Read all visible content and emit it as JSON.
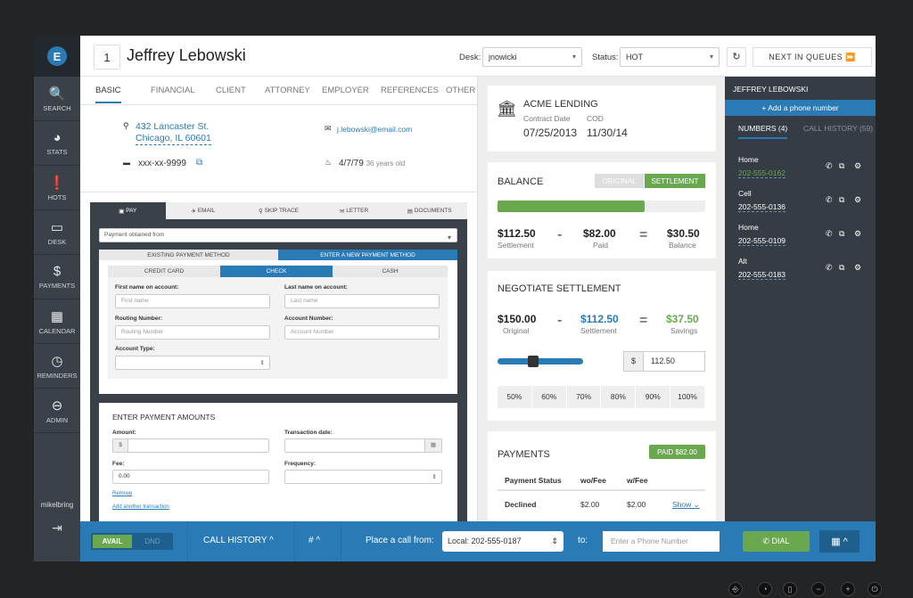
{
  "sidebar": {
    "logo": "E",
    "items": [
      {
        "label": "SEARCH",
        "icon": "🔍"
      },
      {
        "label": "STATS",
        "icon": "◕"
      },
      {
        "label": "HOTS",
        "icon": "❗"
      },
      {
        "label": "DESK",
        "icon": "▭"
      },
      {
        "label": "PAYMENTS",
        "icon": "$"
      },
      {
        "label": "CALENDAR",
        "icon": "▦"
      },
      {
        "label": "REMINDERS",
        "icon": "◷"
      },
      {
        "label": "ADMIN",
        "icon": "⊖"
      }
    ],
    "user": "mikelbring",
    "logout_icon": "⇥"
  },
  "header": {
    "queue_number": "1",
    "name": "Jeffrey Lebowski",
    "desk_label": "Desk:",
    "desk_value": "jnowicki",
    "status_label": "Status:",
    "status_value": "HOT",
    "refresh_icon": "↻",
    "next_label": "NEXT IN QUEUES ⏩"
  },
  "tabs": [
    "BASIC",
    "FINANCIAL",
    "CLIENT",
    "ATTORNEY",
    "EMPLOYER",
    "REFERENCES",
    "OTHER"
  ],
  "basic": {
    "address1": "432 Lancaster St.",
    "address2": "Chicago, IL 60601",
    "email": "j.lebowski@email.com",
    "ssn": "xxx-xx-9999",
    "dob": "4/7/79",
    "age": "36 years old"
  },
  "pay": {
    "tabs": [
      "PAY",
      "EMAIL",
      "SKIP TRACE",
      "LETTER",
      "DOCUMENTS"
    ],
    "obtained_placeholder": "Payment obtained from",
    "method_tabs": [
      "EXISTING PAYMENT METHOD",
      "ENTER A NEW PAYMENT METHOD"
    ],
    "types": [
      "CREDIT CARD",
      "CHECK",
      "CASH"
    ],
    "first_label": "First name on account:",
    "first_ph": "First name",
    "last_label": "Last name on account:",
    "last_ph": "Last name",
    "routing_label": "Routing Number:",
    "routing_ph": "Routing Number",
    "account_label": "Account Number:",
    "account_ph": "Account Number",
    "type_label": "Account Type:"
  },
  "amounts": {
    "title": "ENTER PAYMENT AMOUNTS",
    "amount_label": "Amount:",
    "currency": "$",
    "date_label": "Transaction date:",
    "fee_label": "Fee:",
    "fee_value": "0.00",
    "freq_label": "Frequency:",
    "remove": "Remove",
    "add": "Add another transaction"
  },
  "creditor": {
    "name": "ACME LENDING",
    "contract_label": "Contract Date",
    "contract": "07/25/2013",
    "cod_label": "COD",
    "cod": "11/30/14"
  },
  "balance": {
    "title": "BALANCE",
    "toggle": [
      "ORIGINAL",
      "SETTLEMENT"
    ],
    "progress_percent": 71,
    "settlement": "$112.50",
    "settlement_label": "Settlement",
    "paid": "$82.00",
    "paid_label": "Paid",
    "balance": "$30.50",
    "balance_label": "Balance",
    "minus": "-",
    "equals": "="
  },
  "negotiate": {
    "title": "NEGOTIATE SETTLEMENT",
    "original": "$150.00",
    "original_label": "Original",
    "settlement": "$112.50",
    "settlement_label": "Settlement",
    "savings": "$37.50",
    "savings_label": "Savings",
    "currency": "$",
    "input": "112.50",
    "slider_percent": 40,
    "percents": [
      "50%",
      "60%",
      "70%",
      "80%",
      "90%",
      "100%"
    ]
  },
  "payments": {
    "title": "PAYMENTS",
    "badge": "PAID $82.00",
    "headers": [
      "Payment Status",
      "wo/Fee",
      "w/Fee"
    ],
    "rows": [
      {
        "status": "Declined",
        "wo": "$2.00",
        "w": "$2.00",
        "action": "Show ⌄"
      }
    ]
  },
  "right": {
    "title": "JEFFREY LEBOWSKI",
    "add": "+ Add a phone number",
    "tab_numbers": "NUMBERS (4)",
    "tab_history": "CALL HISTORY (59)",
    "numbers": [
      {
        "type": "Home",
        "number": "202-555-0162"
      },
      {
        "type": "Cell",
        "number": "202-555-0136"
      },
      {
        "type": "Home",
        "number": "202-555-0109"
      },
      {
        "type": "Alt",
        "number": "202-555-0183"
      }
    ]
  },
  "bar": {
    "avail": "AVAIL",
    "dnd": "DND",
    "history": "CALL HISTORY ^",
    "hash": "# ^",
    "from_label": "Place a call from:",
    "from_value": "Local: 202-555-0187",
    "to_label": "to:",
    "to_ph": "Enter a Phone Number",
    "dial": "✆ DIAL",
    "grid": "▦ ^"
  },
  "colors": {
    "accent": "#2a7ab5",
    "green": "#6aa84f",
    "sidebar": "#3a4149"
  }
}
